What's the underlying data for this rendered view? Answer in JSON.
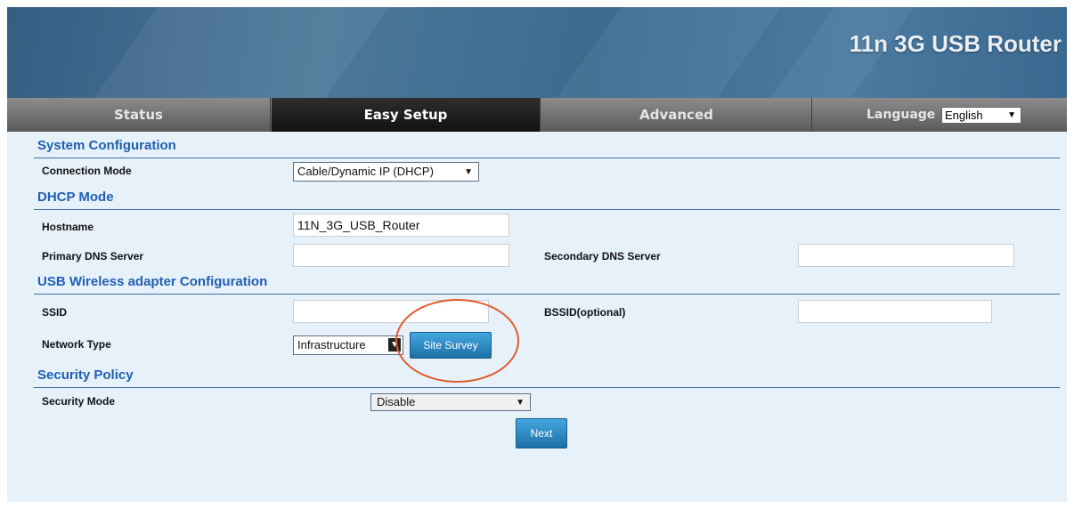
{
  "header": {
    "product_title": "11n 3G USB Router"
  },
  "nav": {
    "tabs": [
      {
        "label": "Status",
        "active": false
      },
      {
        "label": "Easy Setup",
        "active": true
      },
      {
        "label": "Advanced",
        "active": false
      }
    ],
    "language_label": "Language",
    "language_value": "English"
  },
  "sections": {
    "system_config": "System Configuration",
    "dhcp_mode": "DHCP Mode",
    "usb_wireless": "USB Wireless adapter Configuration",
    "security_policy": "Security Policy"
  },
  "fields": {
    "connection_mode": {
      "label": "Connection Mode",
      "value": "Cable/Dynamic IP (DHCP)"
    },
    "hostname": {
      "label": "Hostname",
      "value": "11N_3G_USB_Router"
    },
    "primary_dns": {
      "label": "Primary DNS Server",
      "value": ""
    },
    "secondary_dns": {
      "label": "Secondary DNS Server",
      "value": ""
    },
    "ssid": {
      "label": "SSID",
      "value": ""
    },
    "bssid": {
      "label": "BSSID(optional)",
      "value": ""
    },
    "network_type": {
      "label": "Network Type",
      "value": "Infrastructure"
    },
    "security_mode": {
      "label": "Security Mode",
      "value": "Disable"
    }
  },
  "buttons": {
    "site_survey": "Site Survey",
    "next": "Next"
  },
  "icons": {
    "dropdown": "▼"
  },
  "colors": {
    "section_title": "#1f5fb4",
    "button": "#2f8dc9",
    "highlight_circle": "#e25a2b",
    "page_bg": "#e7f1fa"
  }
}
